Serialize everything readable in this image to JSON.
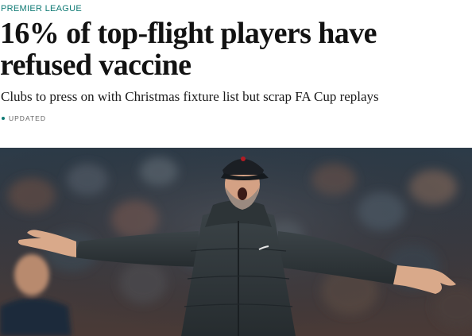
{
  "article": {
    "section": "PREMIER LEAGUE",
    "headline": "16% of top-flight players have refused vaccine",
    "standfirst": "Clubs to press on with Christmas fixture list but scrap FA Cup replays",
    "status": "UPDATED"
  },
  "colors": {
    "accent": "#0f7a74",
    "headline": "#121212",
    "meta": "#666666"
  },
  "image": {
    "icon": "hero-photo"
  }
}
